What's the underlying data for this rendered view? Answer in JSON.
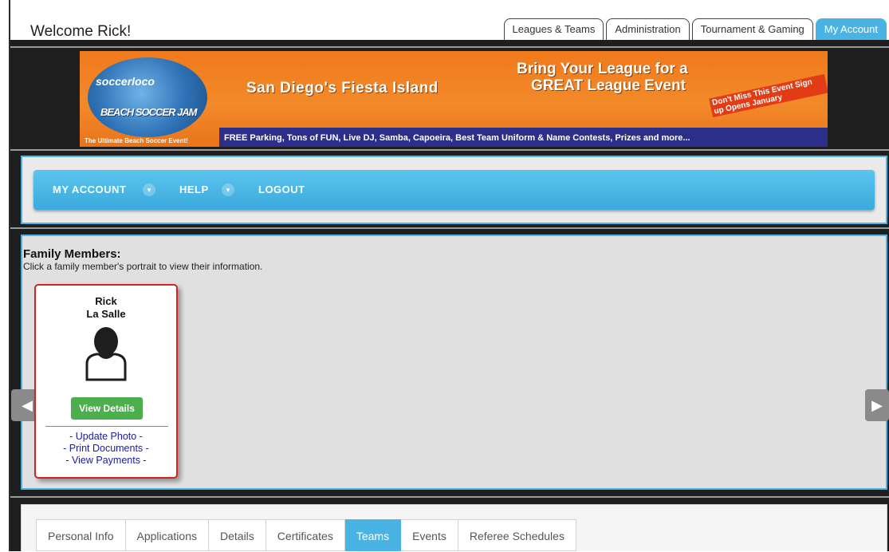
{
  "header": {
    "welcome": "Welcome Rick!",
    "tabs": [
      {
        "label": "Leagues & Teams",
        "active": false
      },
      {
        "label": "Administration",
        "active": false
      },
      {
        "label": "Tournament & Gaming",
        "active": false
      },
      {
        "label": "My Account",
        "active": true
      }
    ]
  },
  "banner": {
    "logo_text": "soccerloco",
    "logo_main": "BEACH SOCCER JAM",
    "logo_tagline": "The Ultimate Beach Soccer Event!",
    "location": "San Diego's Fiesta Island",
    "headline_line1": "Bring Your League for a",
    "headline_line2": "GREAT League Event",
    "promo": "Don't Miss This Event Sign up Opens January",
    "strip": "FREE Parking, Tons of FUN, Live DJ, Samba, Capoeira, Best Team Uniform & Name Contests, Prizes and more..."
  },
  "nav": {
    "my_account": "MY ACCOUNT",
    "help": "HELP",
    "logout": "LOGOUT"
  },
  "family": {
    "title": "Family Members:",
    "hint": "Click a family member's portrait to view their information.",
    "member": {
      "first_name": "Rick",
      "last_name": "La Salle",
      "view_button": "View Details",
      "links": [
        "- Update Photo -",
        "- Print Documents -",
        "- View Payments -"
      ]
    }
  },
  "bottom_tabs": [
    {
      "label": "Personal Info",
      "active": false
    },
    {
      "label": "Applications",
      "active": false
    },
    {
      "label": "Details",
      "active": false
    },
    {
      "label": "Certificates",
      "active": false
    },
    {
      "label": "Teams",
      "active": true
    },
    {
      "label": "Events",
      "active": false
    },
    {
      "label": "Referee Schedules",
      "active": false
    }
  ],
  "colors": {
    "accent": "#49b4e3",
    "card_border": "#d0261f",
    "button_green": "#4cae4c",
    "banner_orange": "#f07a1c"
  }
}
